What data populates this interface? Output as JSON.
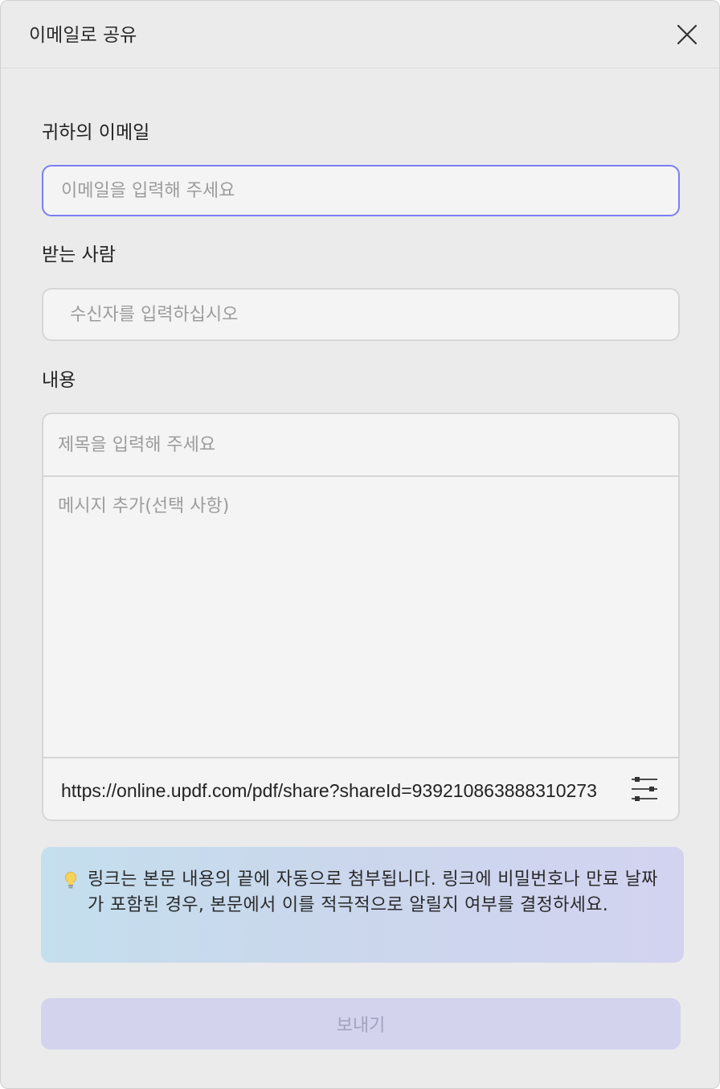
{
  "dialog": {
    "title": "이메일로 공유",
    "close_icon": "close-icon"
  },
  "form": {
    "email_label": "귀하의 이메일",
    "email_placeholder": "이메일을 입력해 주세요",
    "recipient_label": "받는 사람",
    "recipient_placeholder": "수신자를 입력하십시오",
    "content_label": "내용",
    "subject_placeholder": "제목을 입력해 주세요",
    "message_placeholder": "메시지 추가(선택 사항)",
    "share_link": "https://online.updf.com/pdf/share?shareId=939210863888310273",
    "link_settings_icon": "sliders-icon"
  },
  "notice": {
    "icon": "lightbulb-icon",
    "text": "링크는 본문 내용의 끝에 자동으로 첨부됩니다. 링크에 비밀번호나 만료 날짜가 포함된 경우, 본문에서 이를 적극적으로 알릴지 여부를 결정하세요."
  },
  "footer": {
    "send_label": "보내기"
  },
  "colors": {
    "accent_border": "#7b7ef2",
    "send_button_bg": "#d3d3ee",
    "notice_gradient_start": "#c4dfee",
    "notice_gradient_end": "#d3d3f0"
  }
}
